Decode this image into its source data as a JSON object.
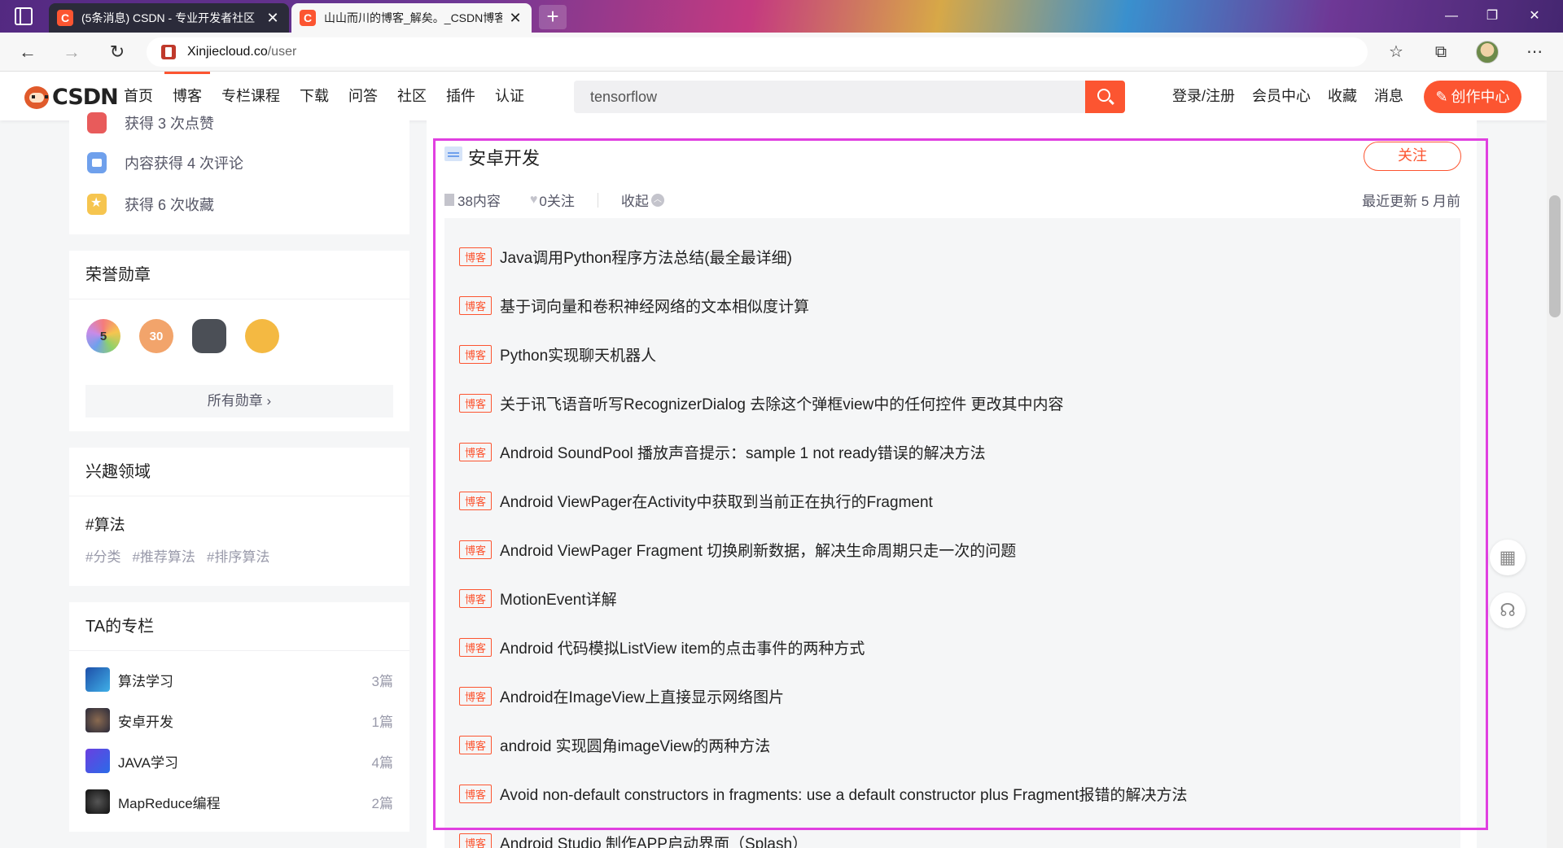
{
  "browser": {
    "tabs": [
      {
        "title": "(5条消息) CSDN - 专业开发者社区",
        "active": false
      },
      {
        "title": "山山而川的博客_解矣。_CSDN博客",
        "active": true
      }
    ],
    "url_host": "Xinjiecloud.co",
    "url_path": "/user"
  },
  "header": {
    "logo": "CSDN",
    "nav": [
      "首页",
      "博客",
      "专栏课程",
      "下载",
      "问答",
      "社区",
      "插件",
      "认证"
    ],
    "search_value": "tensorflow",
    "links": [
      "登录/注册",
      "会员中心",
      "收藏",
      "消息"
    ],
    "create_label": "创作中心"
  },
  "sidebar": {
    "achievements": [
      "获得 3 次点赞",
      "内容获得 4 次评论",
      "获得 6 次收藏"
    ],
    "medals_title": "荣誉勋章",
    "medal_labels": [
      "5",
      "30",
      "",
      ""
    ],
    "all_medals_label": "所有勋章",
    "interests_title": "兴趣领域",
    "interest_main": "#算法",
    "interest_tags": [
      "#分类",
      "#推荐算法",
      "#排序算法"
    ],
    "columns_title": "TA的专栏",
    "columns": [
      {
        "name": "算法学习",
        "count": "3篇"
      },
      {
        "name": "安卓开发",
        "count": "1篇"
      },
      {
        "name": "JAVA学习",
        "count": "4篇"
      },
      {
        "name": "MapReduce编程",
        "count": "2篇"
      }
    ]
  },
  "column": {
    "title": "安卓开发",
    "follow_label": "关注",
    "content_count": "38内容",
    "followers": "0关注",
    "collapse_label": "收起",
    "last_update": "最近更新 5 月前",
    "tag_label": "博客",
    "articles": [
      "Java调用Python程序方法总结(最全最详细)",
      "基于词向量和卷积神经网络的文本相似度计算",
      "Python实现聊天机器人",
      "关于讯飞语音听写RecognizerDialog 去除这个弹框view中的任何控件 更改其中内容",
      "Android SoundPool 播放声音提示：sample 1 not ready错误的解决方法",
      "Android ViewPager在Activity中获取到当前正在执行的Fragment",
      "Android ViewPager Fragment 切换刷新数据，解决生命周期只走一次的问题",
      "MotionEvent详解",
      "Android 代码模拟ListView item的点击事件的两种方式",
      "Android在ImageView上直接显示网络图片",
      "android 实现圆角imageView的两种方法",
      "Avoid non-default constructors in fragments: use a default constructor plus Fragment报错的解决方法",
      "Android Studio 制作APP启动界面（Splash）"
    ]
  }
}
